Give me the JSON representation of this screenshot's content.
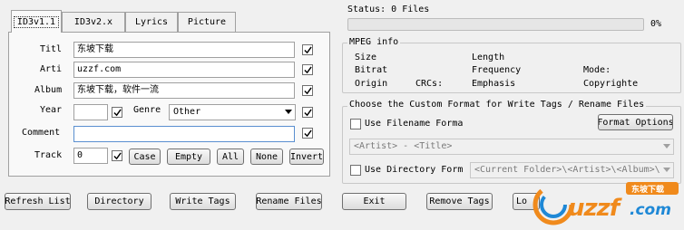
{
  "tabs": [
    {
      "label": "ID3v1.1",
      "active": true
    },
    {
      "label": "ID3v2.x",
      "active": false
    },
    {
      "label": "Lyrics",
      "active": false
    },
    {
      "label": "Picture",
      "active": false
    }
  ],
  "tag_form": {
    "title_label": "Titl",
    "title_value": "东坡下载",
    "artist_label": "Arti",
    "artist_value": "uzzf.com",
    "album_label": "Album",
    "album_value": "东坡下载，软件一流",
    "year_label": "Year",
    "year_value": "",
    "genre_label": "Genre",
    "genre_value": "Other",
    "comment_label": "Comment",
    "comment_value": "",
    "track_label": "Track",
    "track_value": "0",
    "case_button": "Case",
    "empty_button": "Empty",
    "all_button": "All",
    "none_button": "None",
    "invert_button": "Invert"
  },
  "status": {
    "label": "Status: 0 Files",
    "progress_text": "0%",
    "progress_value": 0
  },
  "mpeg": {
    "title": "MPEG info",
    "size_label": "Size",
    "length_label": "Length",
    "bitrate_label": "Bitrat",
    "frequency_label": "Frequency",
    "mode_label": "Mode:",
    "original_label": "Origin",
    "crcs_label": "CRCs:",
    "emphasis_label": "Emphasis",
    "copyright_label": "Copyrighte"
  },
  "custom_format": {
    "title": "Choose the Custom Format for Write Tags / Rename Files",
    "use_filename_label": "Use Filename Forma",
    "format_options_button": "Format Options",
    "filename_format_value": "<Artist> - <Title>",
    "use_directory_label": "Use Directory Form",
    "directory_format_value": "<Current Folder>\\<Artist>\\<Album>\\"
  },
  "bottom_buttons": {
    "refresh": "Refresh List",
    "directory": "Directory",
    "write_tags": "Write Tags",
    "rename_files": "Rename Files",
    "exit": "Exit",
    "remove_tags": "Remove Tags",
    "partial": "Lo"
  },
  "watermark": {
    "brand_text": "uzzf",
    "brand_suffix": ".com",
    "badge_text": "东坡下载",
    "colors": {
      "orange": "#f08a1c",
      "blue": "#1e88d6"
    }
  }
}
